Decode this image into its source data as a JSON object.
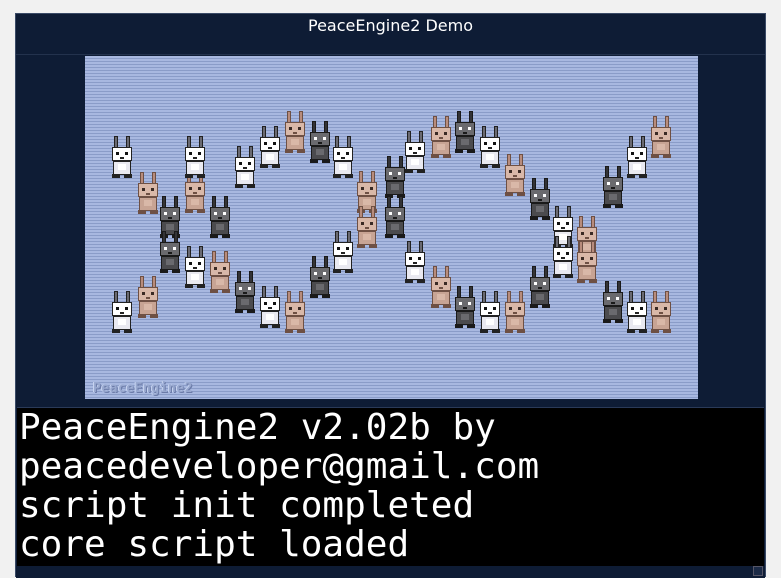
{
  "window": {
    "title": "PeaceEngine2 Demo"
  },
  "stage": {
    "watermark": "PeaceEngine2",
    "sprite_kind": "bunny-sprite",
    "sprite_palettes": {
      "white": {
        "body": "#e9e9f0",
        "ear": "#6a6a72",
        "face": "#ffffff",
        "eye": "#111111",
        "outline": "#222222"
      },
      "dark": {
        "body": "#4b4b4e",
        "ear": "#333336",
        "face": "#6a6a6e",
        "eye": "#ffffff",
        "outline": "#1a1a1a"
      },
      "tan": {
        "body": "#c8a494",
        "ear": "#b88c7c",
        "face": "#d9b8a8",
        "eye": "#3a2a24",
        "outline": "#6e5044"
      }
    },
    "colors": {
      "background": "#a8b8e0",
      "scanline": "#8a9cc8"
    }
  },
  "console": {
    "lines": [
      "PeaceEngine2 v2.02b by",
      "peacedeveloper@gmail.com",
      "script init completed",
      "core script loaded"
    ]
  }
}
